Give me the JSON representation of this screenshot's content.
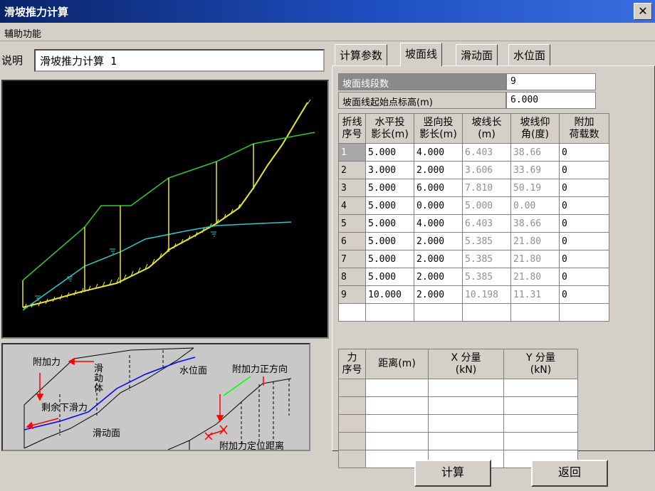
{
  "window": {
    "title": "滑坡推力计算",
    "close_glyph": "✕"
  },
  "menu": {
    "items": [
      "辅助功能"
    ]
  },
  "description": {
    "label": "说明",
    "value": "滑坡推力计算 1"
  },
  "tabs": [
    "计算参数",
    "坡面线",
    "滑动面",
    "水位面"
  ],
  "active_tab": "坡面线",
  "slope_fields": {
    "segments_label": "坡面线段数",
    "segments_value": "9",
    "start_elev_label": "坡面线起始点标高(m)",
    "start_elev_value": "6.000"
  },
  "slope_table": {
    "headers": [
      "折线\n序号",
      "水平投\n影长(m)",
      "竖向投\n影长(m)",
      "坡线长\n(m)",
      "坡线仰\n角(度)",
      "附加\n荷载数"
    ],
    "rows": [
      [
        "1",
        "5.000",
        "4.000",
        "6.403",
        "38.66",
        "0"
      ],
      [
        "2",
        "3.000",
        "2.000",
        "3.606",
        "33.69",
        "0"
      ],
      [
        "3",
        "5.000",
        "6.000",
        "7.810",
        "50.19",
        "0"
      ],
      [
        "4",
        "5.000",
        "0.000",
        "5.000",
        "0.00",
        "0"
      ],
      [
        "5",
        "5.000",
        "4.000",
        "6.403",
        "38.66",
        "0"
      ],
      [
        "6",
        "5.000",
        "2.000",
        "5.385",
        "21.80",
        "0"
      ],
      [
        "7",
        "5.000",
        "2.000",
        "5.385",
        "21.80",
        "0"
      ],
      [
        "8",
        "5.000",
        "2.000",
        "5.385",
        "21.80",
        "0"
      ],
      [
        "9",
        "10.000",
        "2.000",
        "10.198",
        "11.31",
        "0"
      ]
    ]
  },
  "force_table": {
    "headers": [
      "力\n序号",
      "距离(m)",
      "X 分量\n(kN)",
      "Y 分量\n(kN)"
    ],
    "empty_rows": 5
  },
  "diagram_labels": {
    "additional_force": "附加力",
    "sliding_body": "滑\n动\n体",
    "water_surface": "水位面",
    "residual_slide_force": "剩余下滑力",
    "sliding_surface": "滑动面",
    "force_direction": "附加力正方向",
    "force_position": "附加力定位距离"
  },
  "buttons": {
    "calculate": "计算",
    "back": "返回"
  },
  "colors": {
    "title_bar": "#0a246a",
    "slope_line": "#32c832",
    "slip_surface": "#e6e632",
    "water_line": "#32c8c8",
    "canvas_bg": "#000000"
  }
}
